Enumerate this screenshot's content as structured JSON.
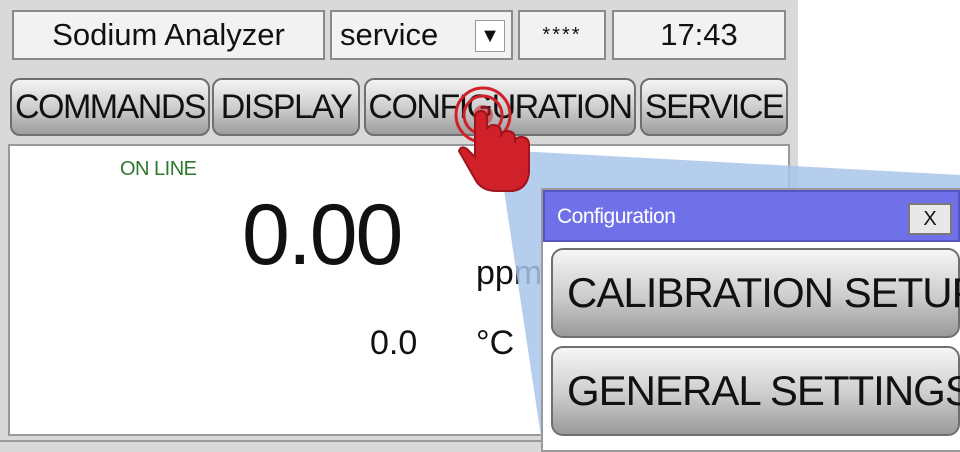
{
  "status_bar": {
    "title": "Sodium Analyzer",
    "user": "service",
    "password": "****",
    "time": "17:43"
  },
  "tabs": [
    {
      "label": "COMMANDS"
    },
    {
      "label": "DISPLAY"
    },
    {
      "label": "CONFIGURATION"
    },
    {
      "label": "SERVICE"
    }
  ],
  "display": {
    "status": "ON LINE",
    "value": "0.00",
    "unit": "ppm",
    "temperature": "0.0",
    "temperature_unit": "°C"
  },
  "popup": {
    "title": "Configuration",
    "close_label": "X",
    "buttons": [
      {
        "label": "CALIBRATION SETUP"
      },
      {
        "label": "GENERAL SETTINGS"
      }
    ]
  },
  "icons": {
    "user_dropdown": "dropdown-arrow-icon",
    "pointer": "touch-hand-icon"
  },
  "colors": {
    "popup_title_bg": "#7070e8",
    "online_text": "#2d7a2d",
    "touch_indicator": "#d0202a",
    "callout": "#a9c6ea"
  }
}
